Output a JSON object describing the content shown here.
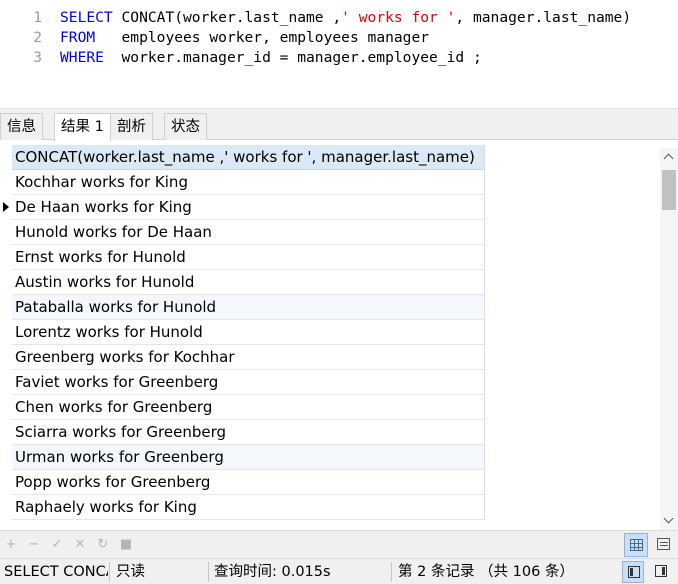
{
  "editor": {
    "lines": [
      {
        "num": "1",
        "parts": [
          {
            "t": "SELECT",
            "c": "kw"
          },
          {
            "t": " CONCAT(worker.last_name ,",
            "c": ""
          },
          {
            "t": "' works for '",
            "c": "str"
          },
          {
            "t": ", manager.last_name)",
            "c": ""
          }
        ]
      },
      {
        "num": "2",
        "parts": [
          {
            "t": "FROM",
            "c": "kw"
          },
          {
            "t": "   employees worker, employees manager",
            "c": ""
          }
        ]
      },
      {
        "num": "3",
        "parts": [
          {
            "t": "WHERE",
            "c": "kw"
          },
          {
            "t": "  worker.manager_id = manager.employee_id ;",
            "c": ""
          }
        ]
      }
    ]
  },
  "tabs": [
    {
      "label": "信息",
      "active": false
    },
    {
      "label": "结果 1",
      "active": true
    },
    {
      "label": "剖析",
      "active": false
    },
    {
      "label": "状态",
      "active": false
    }
  ],
  "grid": {
    "column_header": "CONCAT(worker.last_name ,' works for ', manager.last_name)",
    "current_row_index": 1,
    "rows": [
      "Kochhar works for King",
      "De Haan works for King",
      "Hunold works for De Haan",
      "Ernst works for Hunold",
      "Austin works for Hunold",
      "Pataballa works for Hunold",
      "Lorentz works for Hunold",
      "Greenberg works for Kochhar",
      "Faviet works for Greenberg",
      "Chen works for Greenberg",
      "Sciarra works for Greenberg",
      "Urman works for Greenberg",
      "Popp works for Greenberg",
      "Raphaely works for King"
    ]
  },
  "toolbar": {
    "icons": [
      {
        "name": "add-record-icon",
        "glyph": "+"
      },
      {
        "name": "delete-record-icon",
        "glyph": "−"
      },
      {
        "name": "apply-changes-icon",
        "glyph": "✓"
      },
      {
        "name": "discard-changes-icon",
        "glyph": "✕"
      },
      {
        "name": "refresh-icon",
        "glyph": "↻"
      },
      {
        "name": "stop-icon",
        "glyph": "■"
      }
    ]
  },
  "status": {
    "query_text": "SELECT CONCAT(worker.last_name ,' works for ', manager.last_name)",
    "mode": "只读",
    "query_time": "查询时间: 0.015s",
    "record_info": "第 2 条记录 （共 106 条）"
  },
  "colors": {
    "keyword": "#0000e6",
    "string": "#e60000",
    "header_bg": "#dbe8f5",
    "alt_row_bg": "#f4f8fc"
  }
}
